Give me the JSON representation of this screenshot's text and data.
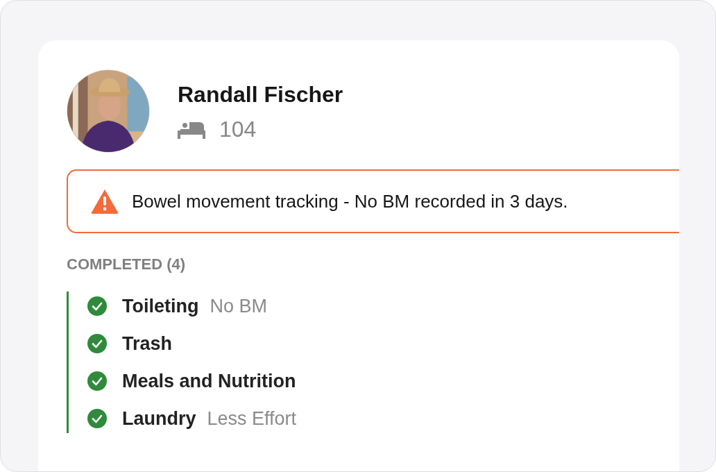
{
  "resident": {
    "name": "Randall Fischer",
    "room": "104"
  },
  "alert": {
    "text": "Bowel movement tracking - No BM recorded in 3 days."
  },
  "completed": {
    "heading": "COMPLETED (4)",
    "items": [
      {
        "label": "Toileting",
        "note": "No BM",
        "done": true
      },
      {
        "label": "Trash",
        "done": true
      },
      {
        "label": "Meals and Nutrition",
        "done": true
      },
      {
        "label": "Laundry",
        "note": "Less Effort",
        "done": true
      }
    ]
  }
}
